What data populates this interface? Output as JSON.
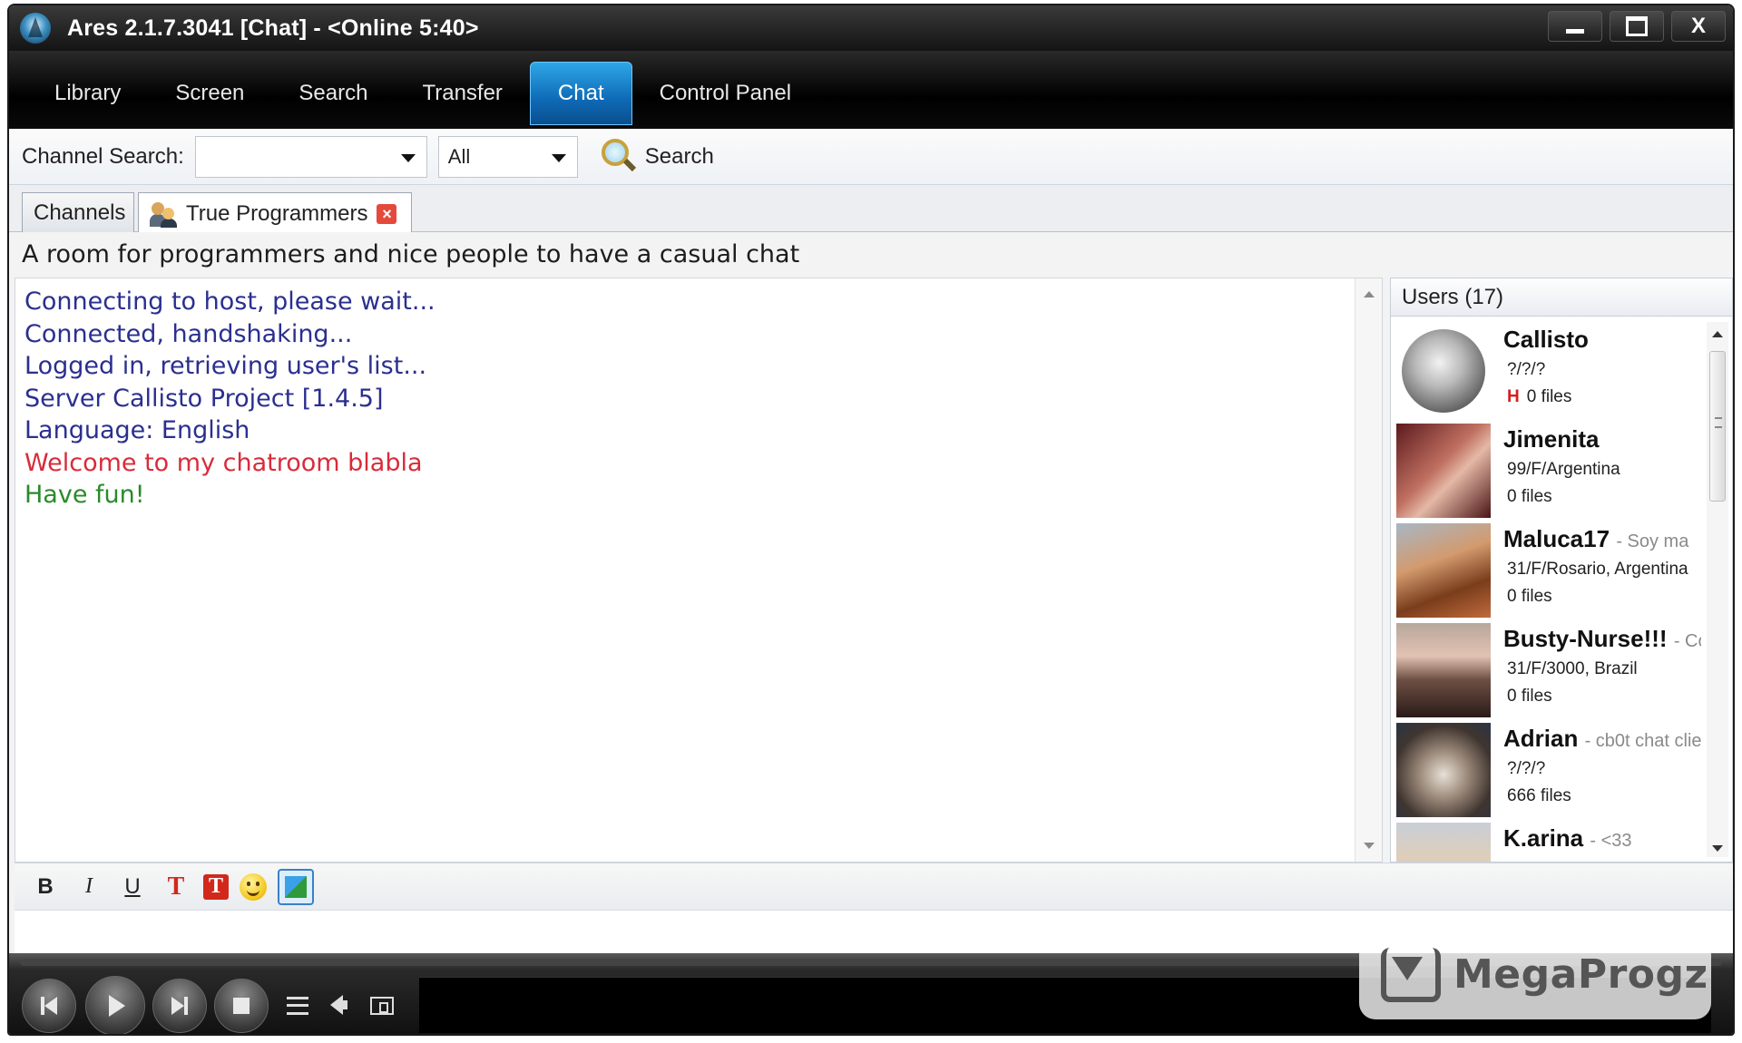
{
  "window": {
    "title": "Ares 2.1.7.3041  [Chat]  -  <Online 5:40>",
    "controls": {
      "close": "X"
    }
  },
  "menu": {
    "items": [
      "Library",
      "Screen",
      "Search",
      "Transfer",
      "Chat",
      "Control Panel"
    ],
    "active": "Chat"
  },
  "channel_search": {
    "label": "Channel Search:",
    "query_value": "",
    "filter_value": "All",
    "search_label": "Search"
  },
  "tabs": {
    "channels_label": "Channels",
    "room_label": "True Programmers"
  },
  "room": {
    "topic": "A room for programmers and nice people to have a casual chat"
  },
  "chat_log": {
    "lines": [
      {
        "text": "Connecting to host, please wait...",
        "color": "#2b2f8f"
      },
      {
        "text": "Connected, handshaking...",
        "color": "#2b2f8f"
      },
      {
        "text": "Logged in, retrieving user's list...",
        "color": "#2b2f8f"
      },
      {
        "text": "Server Callisto Project [1.4.5]",
        "color": "#2b2f8f"
      },
      {
        "text": "Language: English",
        "color": "#2b2f8f"
      },
      {
        "text": "Welcome to my chatroom blabla",
        "color": "#d92b3a"
      },
      {
        "text": "Have fun!",
        "color": "#2a8a2a"
      }
    ]
  },
  "users": {
    "header": "Users (17)",
    "list": [
      {
        "name": "Callisto",
        "status": "",
        "info": "?/?/?",
        "flag": "H",
        "files": "0 files"
      },
      {
        "name": "Jimenita",
        "status": "",
        "info": "99/F/Argentina",
        "flag": "",
        "files": "0 files"
      },
      {
        "name": "Maluca17",
        "status": "- Soy ma",
        "info": "31/F/Rosario, Argentina",
        "flag": "",
        "files": "0 files"
      },
      {
        "name": "Busty-Nurse!!!",
        "status": "- Co",
        "info": "31/F/3000, Brazil",
        "flag": "",
        "files": "0 files"
      },
      {
        "name": "Adrian",
        "status": "- cb0t chat clie",
        "info": "?/?/?",
        "flag": "",
        "files": "666 files"
      },
      {
        "name": "K.arina",
        "status": "- <33",
        "info": "",
        "flag": "",
        "files": ""
      }
    ]
  },
  "format_toolbar": {
    "bold": "B",
    "italic": "I",
    "underline": "U",
    "text_color": "T",
    "bg_color": "T"
  },
  "input": {
    "value": ""
  },
  "watermark": {
    "text": "MegaProgz"
  },
  "colors": {
    "accent": "#0e6ab7",
    "system_text": "#2b2f8f",
    "welcome_text": "#d92b3a",
    "fun_text": "#2a8a2a"
  }
}
